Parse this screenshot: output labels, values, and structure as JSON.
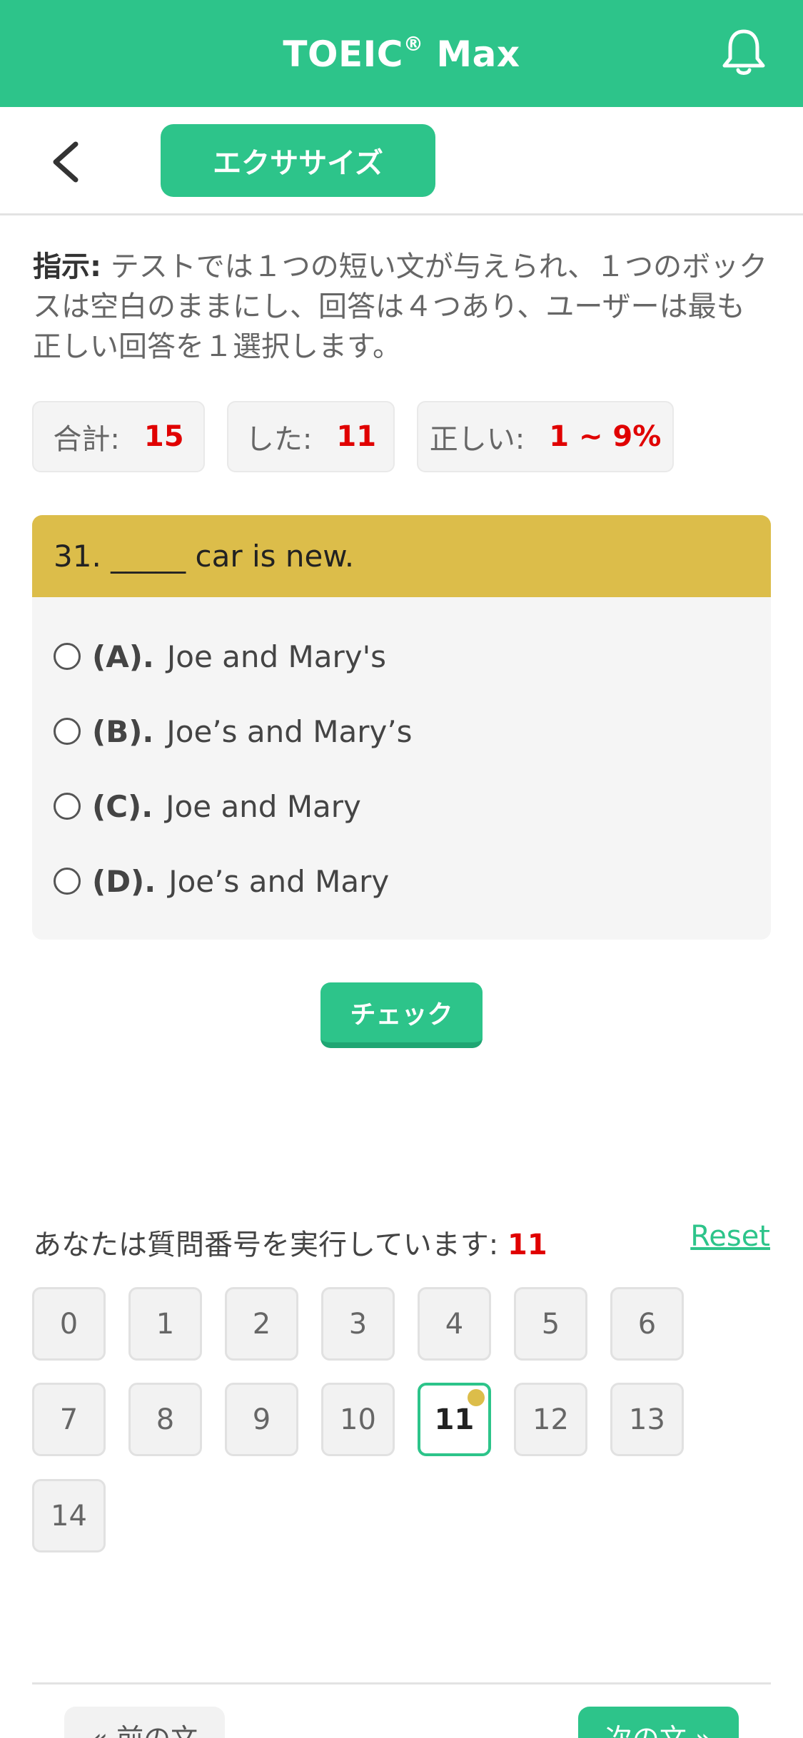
{
  "header": {
    "title": "TOEIC",
    "title_sup": "®",
    "title_suffix": " Max"
  },
  "subbar": {
    "tab_label": "エクササイズ"
  },
  "instructions": {
    "label": "指示:",
    "text": " テストでは１つの短い文が与えられ、１つのボックスは空白のままにし、回答は４つあり、ユーザーは最も正しい回答を１選択します。"
  },
  "stats": {
    "total_label": "合計:",
    "total_value": "15",
    "done_label": "した:",
    "done_value": "11",
    "correct_label": "正しい:",
    "correct_value": "1 ~ 9%"
  },
  "question": {
    "text": "31. _____ car is new.",
    "options": [
      {
        "letter": "(A).",
        "text": "Joe and Mary's"
      },
      {
        "letter": "(B).",
        "text": "Joe’s and Mary’s"
      },
      {
        "letter": "(C).",
        "text": "Joe and Mary"
      },
      {
        "letter": "(D).",
        "text": "Joe’s and Mary"
      }
    ]
  },
  "check_button": "チェック",
  "progress": {
    "label": "あなたは質問番号を実行しています:",
    "current": "11",
    "reset": "Reset",
    "numbers": [
      "0",
      "1",
      "2",
      "3",
      "4",
      "5",
      "6",
      "7",
      "8",
      "9",
      "10",
      "11",
      "12",
      "13",
      "14"
    ]
  },
  "footer": {
    "prev": "« 前の文",
    "next": "次の文 »"
  },
  "colors": {
    "brand": "#2dc48a",
    "question_header": "#dcbd4a",
    "highlight": "#e00000"
  },
  "icons": {
    "notification": "bell-icon",
    "back": "chevron-left-icon"
  }
}
